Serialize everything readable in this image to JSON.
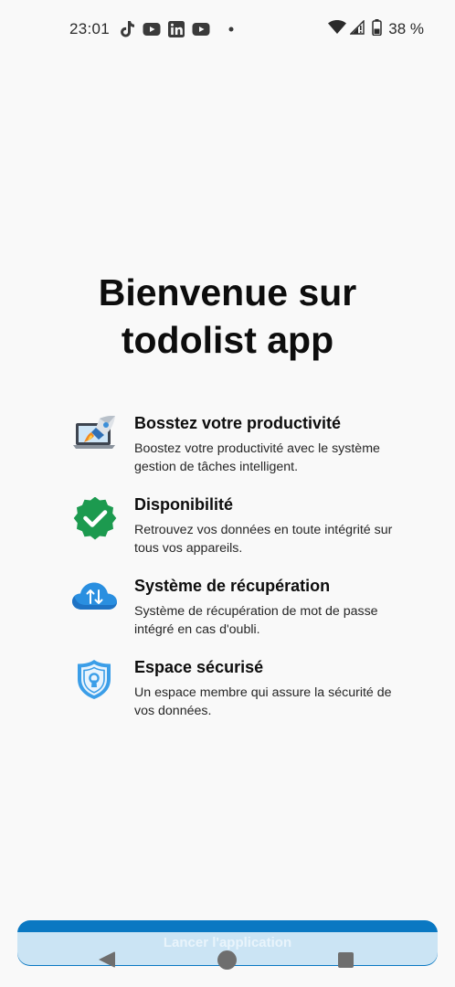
{
  "status_bar": {
    "time": "23:01",
    "notification_icons": [
      "tiktok-icon",
      "youtube-icon",
      "linkedin-icon",
      "youtube-icon",
      "more-dot-icon"
    ],
    "system_icons": [
      "wifi-icon",
      "cell-signal-icon",
      "battery-icon"
    ],
    "battery": "38 %"
  },
  "welcome": {
    "title_line1": "Bienvenue sur",
    "title_line2": "todolist app"
  },
  "features": [
    {
      "icon": "rocket-laptop-icon",
      "title": "Bosstez votre productivité",
      "description": "Boostez votre productivité avec le système gestion de tâches intelligent."
    },
    {
      "icon": "checkmark-badge-icon",
      "title": "Disponibilité",
      "description": "Retrouvez vos données en toute intégrité sur tous vos appareils."
    },
    {
      "icon": "cloud-sync-icon",
      "title": "Système de récupération",
      "description": "Système de récupération de mot de passe intégré en cas d'oubli."
    },
    {
      "icon": "shield-lock-icon",
      "title": "Espace sécurisé",
      "description": "Un espace membre qui assure la sécurité de vos données."
    }
  ],
  "launch_button": {
    "label": "Lancer l'application"
  },
  "navigation": {
    "buttons": [
      "back-icon",
      "home-icon",
      "recents-icon"
    ]
  },
  "colors": {
    "background": "#f9f9f9",
    "accent": "#0a78c2",
    "check_green": "#1c9a4f",
    "cloud_blue": "#2a8fe0",
    "shield_blue": "#3b9ee8"
  }
}
